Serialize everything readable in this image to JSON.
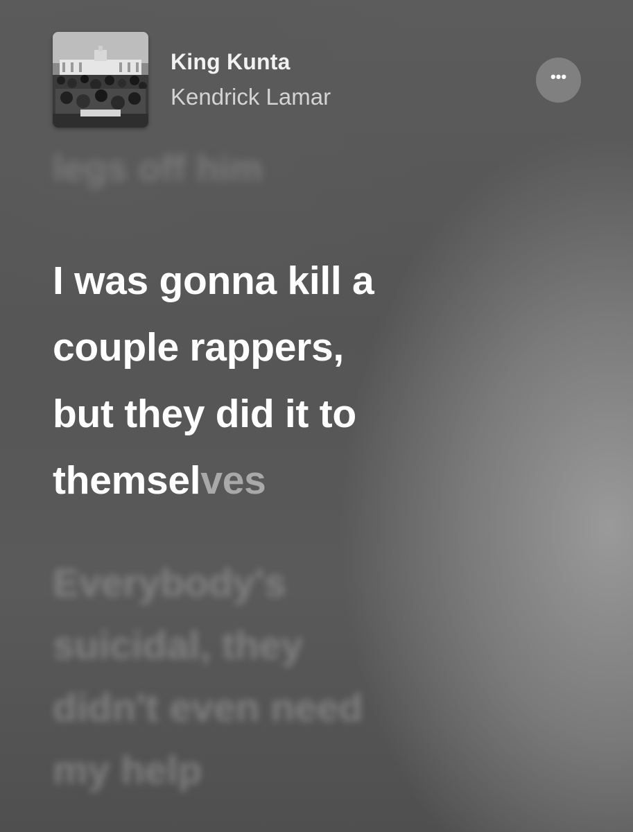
{
  "now_playing": {
    "title": "King Kunta",
    "artist": "Kendrick Lamar",
    "more_icon": "ellipsis-icon",
    "more_label": "•••"
  },
  "lyrics": {
    "previous_line": "legs off him",
    "current_lines": [
      "I was gonna kill a",
      "couple rappers,",
      "but they did it to"
    ],
    "current_last_sung": "themsel",
    "current_last_unsung": "ves",
    "next_lines": [
      "Everybody's",
      "suicidal, they",
      "didn't even need",
      "my help"
    ]
  },
  "colors": {
    "background": "#5a5a5a",
    "active_lyric": "#ffffff",
    "unsung_lyric": "#a9a9a9"
  }
}
